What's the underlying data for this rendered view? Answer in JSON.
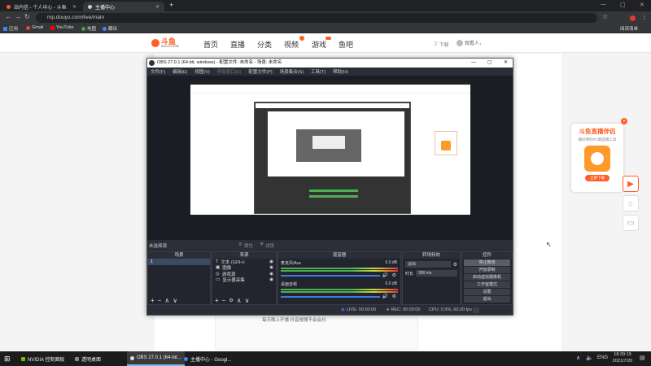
{
  "browser": {
    "tabs": [
      {
        "title": "站内信 - 个人中心 - 斗鱼"
      },
      {
        "title": "主播中心"
      }
    ],
    "new_tab": "+",
    "address": "mp.douyu.com/live/main",
    "bookmarks": [
      "应用",
      "Gmail",
      "YouTube",
      "地图",
      "翻译"
    ],
    "reading_list": "阅读清单"
  },
  "douyu": {
    "logo_text": "斗鱼",
    "logo_sub": "DOUYU.COM",
    "nav": [
      "首页",
      "直播",
      "分类",
      "视频",
      "游戏",
      "鱼吧"
    ],
    "download": "下载",
    "username": "观看人↓",
    "bottom_text": "每天晚上开播 抖音搜搜不会会抖"
  },
  "obs": {
    "title": "OBS 27.0.1 (64-bit, windows) - 配置文件: 未命名 - 场景: 未命名",
    "menu": [
      "文件(F)",
      "编辑(E)",
      "视图(V)",
      "停靠窗口(D)",
      "配置文件(P)",
      "场景集合(S)",
      "工具(T)",
      "帮助(H)"
    ],
    "no_source": "未选择源",
    "props_btn": "属性",
    "filters_btn": "滤镜",
    "docks": {
      "scenes": {
        "title": "场景",
        "items": [
          "1"
        ]
      },
      "sources": {
        "title": "来源",
        "items": [
          {
            "icon": "T",
            "label": "文本 (GDI+)"
          },
          {
            "icon": "▣",
            "label": "图像"
          },
          {
            "icon": "◎",
            "label": "游戏源"
          },
          {
            "icon": "▭",
            "label": "显示器采集"
          }
        ]
      },
      "mixer": {
        "title": "混音器",
        "tracks": [
          {
            "name": "麦克风/Aux",
            "level": "0.0 dB"
          },
          {
            "name": "桌面音频",
            "level": "0.0 dB"
          }
        ]
      },
      "transitions": {
        "title": "转场特效",
        "type": "淡出",
        "duration_label": "时长",
        "duration": "300 ms"
      },
      "controls": {
        "title": "控件",
        "buttons": [
          "停止推流",
          "开始录制",
          "启动虚拟摄像机",
          "工作室模式",
          "设置",
          "退出"
        ]
      }
    },
    "status": {
      "live": "LIVE: 00:00:00",
      "rec": "REC: 00:00:00",
      "cpu": "CPU: 0.9%, 60.00 fps"
    }
  },
  "promo": {
    "title": "斗鱼直播伴侣",
    "subtitle": "最好用的PC端直播工具",
    "download": "立即下载"
  },
  "taskbar": {
    "items": [
      "NVIDIA 控制面板",
      "透明桌面",
      "OBS 27.0.1 (64-bit...",
      "主播中心 - Googl..."
    ],
    "lang": "ENG",
    "time": "18:39:19",
    "date": "2021/7/20"
  },
  "colors": {
    "douyu_orange": "#ff5d23",
    "obs_bg": "#2b2e38",
    "accent": "#76b9ed"
  }
}
